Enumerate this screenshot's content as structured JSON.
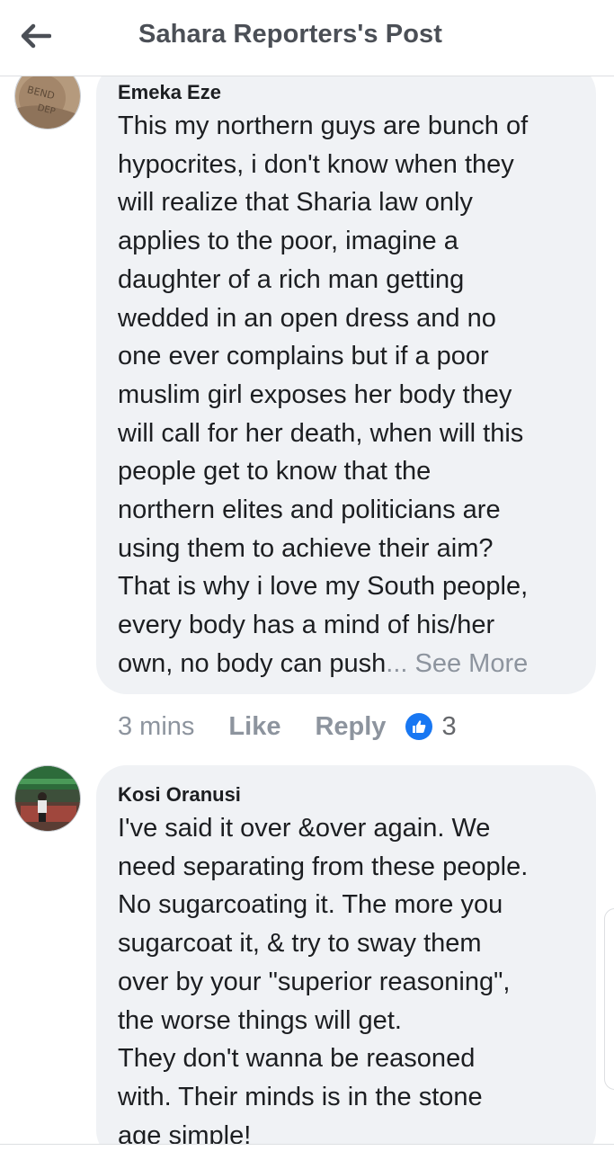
{
  "header": {
    "back_icon": "arrow-left-icon",
    "title": "Sahara Reporters's Post"
  },
  "comments": [
    {
      "author": "Emeka Eze",
      "text": "This my northern guys are bunch of\nhypocrites, i don't know when they\nwill realize that Sharia law only\napplies to the poor, imagine a\ndaughter of a rich man getting\nwedded in an open dress and no\none ever complains but if a poor\nmuslim girl exposes her body they\nwill call for her death, when will this\npeople get to know that the\nnorthern elites and politicians are\nusing them to achieve their aim?\nThat is why i love my South people,\nevery body has a mind of his/her\nown, no body can push",
      "see_more": "... See More",
      "time": "3 mins",
      "like_label": "Like",
      "reply_label": "Reply",
      "reaction_icon": "thumbs-up-icon",
      "reaction_count": "3"
    },
    {
      "author": "Kosi Oranusi",
      "text": "I've said it over &over again. We\nneed separating from these people.\nNo sugarcoating it. The more you\nsugarcoat it, & try to sway them\nover by your \"superior reasoning\",\nthe worse things will get.\nThey don't wanna be reasoned\nwith. Their minds is in the stone\nage simple!"
    }
  ],
  "colors": {
    "bubble": "#f0f2f5",
    "muted": "#8d949e",
    "accent": "#1877f2",
    "header_text": "#4b4f56"
  }
}
